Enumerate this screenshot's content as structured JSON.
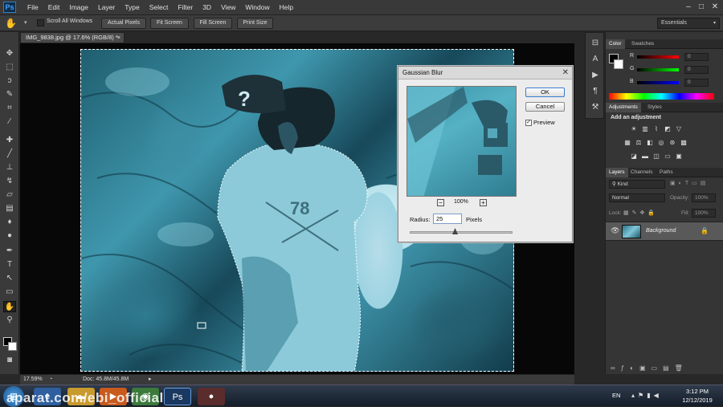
{
  "app": {
    "logo": "Ps",
    "colors": {
      "accent": "#3a93a7",
      "selection": "#3399ff"
    }
  },
  "menu": [
    "File",
    "Edit",
    "Image",
    "Layer",
    "Type",
    "Select",
    "Filter",
    "3D",
    "View",
    "Window",
    "Help"
  ],
  "window_controls": {
    "minimize": "–",
    "restore": "□",
    "close": "✕"
  },
  "options": {
    "scroll_all_windows": "Scroll All Windows",
    "actual_pixels": "Actual Pixels",
    "fit_screen": "Fit Screen",
    "fill_screen": "Fill Screen",
    "print_size": "Print Size",
    "workspace": "Essentials"
  },
  "document": {
    "tab": "IMG_9838.jpg @ 17.6% (RGB/8) *",
    "zoom": "17.59%",
    "doc_info": "Doc: 45.8M/45.8M"
  },
  "dialog": {
    "title": "Gaussian Blur",
    "ok": "OK",
    "cancel": "Cancel",
    "preview_label": "Preview",
    "preview_checked": true,
    "zoom": "100%",
    "radius_label": "Radius:",
    "radius_value": "25",
    "radius_unit": "Pixels"
  },
  "color_panel": {
    "tabs": [
      "Color",
      "Swatches"
    ],
    "channels": [
      {
        "name": "R",
        "value": "0"
      },
      {
        "name": "G",
        "value": "0"
      },
      {
        "name": "B",
        "value": "0"
      }
    ]
  },
  "adjustments_panel": {
    "tabs": [
      "Adjustments",
      "Styles"
    ],
    "heading": "Add an adjustment"
  },
  "layers_panel": {
    "tabs": [
      "Layers",
      "Channels",
      "Paths"
    ],
    "kind": "Kind",
    "blend": "Normal",
    "opacity_label": "Opacity:",
    "opacity": "100%",
    "lock_label": "Lock:",
    "fill_label": "Fill:",
    "fill": "100%",
    "layers": [
      {
        "name": "Background"
      }
    ]
  },
  "taskbar": {
    "lang": "EN",
    "time": "3:12 PM",
    "date": "12/12/2019",
    "watermark": "aparat.com/ebi_official"
  }
}
